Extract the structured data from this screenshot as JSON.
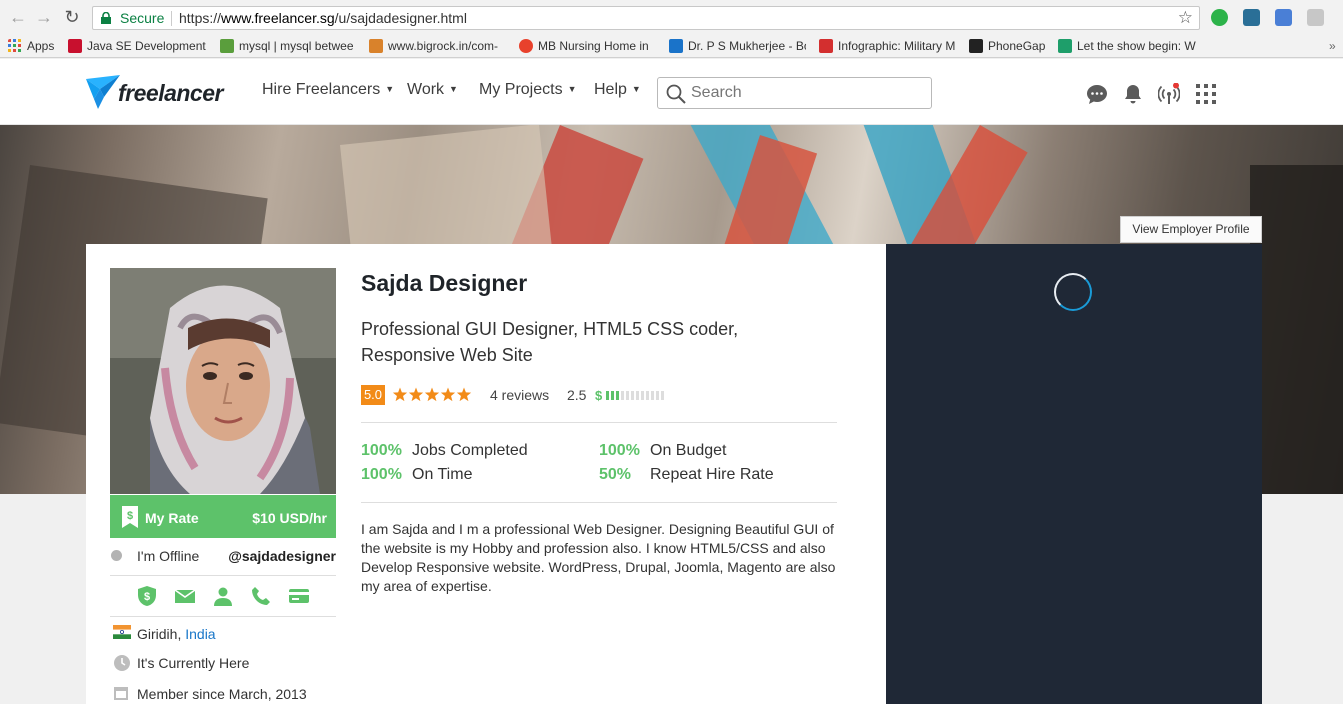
{
  "browser": {
    "secure_label": "Secure",
    "url_scheme": "https://",
    "url_host": "www.freelancer.sg",
    "url_path": "/u/sajdadesigner.html"
  },
  "bookmarks": [
    {
      "label": "Apps",
      "color": "#e04a3f"
    },
    {
      "label": "Java SE Development",
      "color": "#c8102e"
    },
    {
      "label": "mysql | mysql betwee",
      "color": "#5a9e3c"
    },
    {
      "label": "www.bigrock.in/com-",
      "color": "#d9822b"
    },
    {
      "label": "MB Nursing Home in",
      "color": "#e8412c"
    },
    {
      "label": "Dr. P S Mukherjee - Bo",
      "color": "#1a73c9"
    },
    {
      "label": "Infographic: Military M",
      "color": "#d32f2f"
    },
    {
      "label": "PhoneGap",
      "color": "#222222"
    },
    {
      "label": "Let the show begin: W",
      "color": "#1e9e6a"
    }
  ],
  "header": {
    "logo_text": "freelancer",
    "menu": [
      {
        "label": "Hire Freelancers"
      },
      {
        "label": "Work"
      },
      {
        "label": "My Projects"
      },
      {
        "label": "Help"
      }
    ],
    "search_placeholder": "Search"
  },
  "banner": {
    "view_employer_profile": "View Employer Profile"
  },
  "profile": {
    "name": "Sajda Designer",
    "tagline": "Professional GUI Designer, HTML5 CSS coder, Responsive Web Site",
    "rating": "5.0",
    "stars": 5,
    "reviews": "4 reviews",
    "earnings_score": "2.5",
    "earnings_level": 0.25,
    "rate_label": "My Rate",
    "rate_value": "$10 USD/hr",
    "status": "I'm Offline",
    "username": "@sajdadesigner",
    "location_city": "Giridih, ",
    "location_country": "India",
    "local_time": "It's Currently Here",
    "member_since": "Member since March, 2013",
    "stats": [
      {
        "pct": "100%",
        "label": "Jobs Completed"
      },
      {
        "pct": "100%",
        "label": "On Budget"
      },
      {
        "pct": "100%",
        "label": "On Time"
      },
      {
        "pct": "50%",
        "label": "Repeat Hire Rate"
      }
    ],
    "bio": "I am Sajda and I m a professional Web Designer. Designing Beautiful GUI of the website is my Hobby and profession also. I know HTML5/CSS and also Develop Responsive website. WordPress, Drupal, Joomla, Magento are also my area of expertise."
  },
  "colors": {
    "accent_green": "#5dc26a",
    "rating_orange": "#f28b18",
    "link_blue": "#1976c8",
    "dark_panel": "#1f2836"
  }
}
